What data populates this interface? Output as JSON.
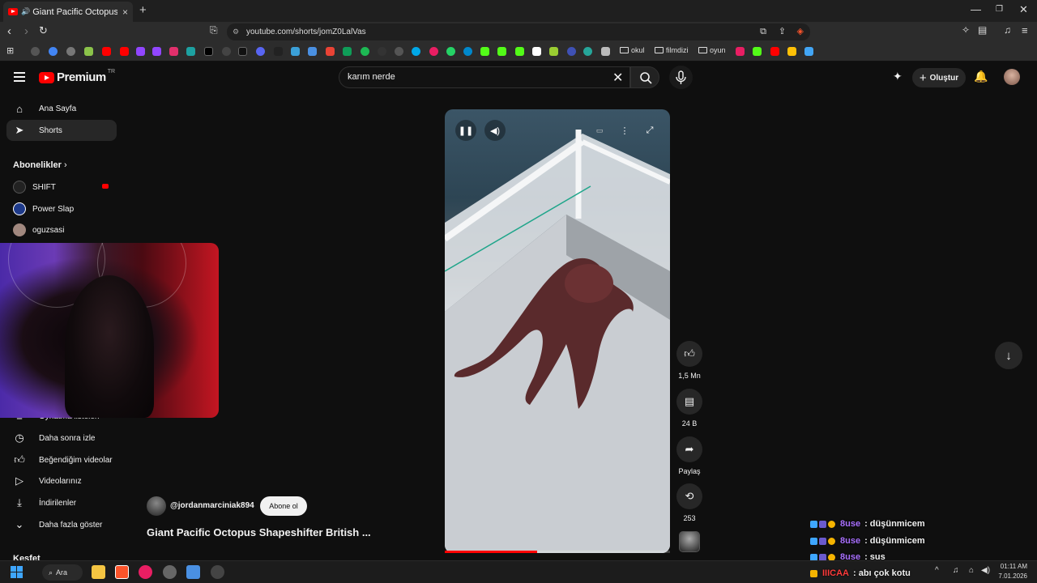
{
  "browser": {
    "tab_title": "Giant Pacific Octopus Shapesh",
    "url": "youtube.com/shorts/jomZ0LalVas",
    "bookmark_folders": [
      "okul",
      "filmdizi",
      "oyun"
    ]
  },
  "header": {
    "logo": "Premium",
    "country": "TR",
    "search_value": "karım nerde",
    "create_label": "Oluştur"
  },
  "sidebar": {
    "items": [
      {
        "label": "Ana Sayfa",
        "icon": "home-icon"
      },
      {
        "label": "Shorts",
        "icon": "shorts-icon"
      }
    ],
    "subscriptions_title": "Abonelikler",
    "subscriptions": [
      {
        "label": "SHIFT"
      },
      {
        "label": "Power Slap"
      },
      {
        "label": "oguzsasi"
      }
    ],
    "lower_items": [
      {
        "label": "Oynatma listeleri"
      },
      {
        "label": "Daha sonra izle"
      },
      {
        "label": "Beğendiğim videolar"
      },
      {
        "label": "Videolarınız"
      },
      {
        "label": "İndirilenler"
      },
      {
        "label": "Daha fazla göster"
      }
    ],
    "explore_title": "Keşfet"
  },
  "short": {
    "progress": 0.41,
    "likes": "1,5 Mn",
    "comments": "24 B",
    "share_label": "Paylaş",
    "remix_count": "253",
    "channel": "@jordanmarciniak894",
    "subscribe_label": "Abone ol",
    "title": "Giant Pacific Octopus Shapeshifter British ..."
  },
  "chat": [
    {
      "user": "8use",
      "message": ": düşünmicem"
    },
    {
      "user": "8use",
      "message": ": düşünmicem"
    },
    {
      "user": "8use",
      "message": ": sus"
    },
    {
      "user": "IIICAA",
      "message": ": abı çok kotu"
    }
  ],
  "taskbar": {
    "search_label": "Ara",
    "time": "01:11 AM",
    "date": "7.01.2026"
  },
  "colors": {
    "brand_red": "#ff0000",
    "background": "#0f0f0f",
    "chat_user_purple": "#a970ff",
    "chat_user_red": "#ff3b3b"
  }
}
